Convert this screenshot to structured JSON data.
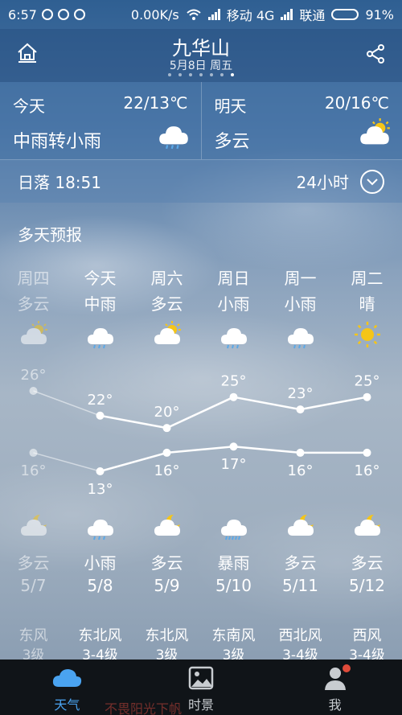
{
  "status_bar": {
    "time": "6:57",
    "speed": "0.00K/s",
    "carrier1": "移动 4G",
    "carrier2": "联通",
    "battery": "91%",
    "battery_level": 0.91
  },
  "header": {
    "city": "九华山",
    "date": "5月8日 周五",
    "page_dots": 7,
    "active_dot": 6,
    "home_icon": "home-icon",
    "share_icon": "share-icon"
  },
  "today": {
    "label": "今天",
    "temp": "22/13℃",
    "condition": "中雨转小雨",
    "icon": "rain-cloud-icon"
  },
  "tomorrow": {
    "label": "明天",
    "temp": "20/16℃",
    "condition": "多云",
    "icon": "partly-cloudy-icon"
  },
  "sunset": {
    "text": "日落 18:51",
    "hours_label": "24小时"
  },
  "forecast_title": "多天预报",
  "chart_data": {
    "type": "line",
    "categories": [
      "5/7",
      "5/8",
      "5/9",
      "5/10",
      "5/11",
      "5/12"
    ],
    "series": [
      {
        "values": [
          26,
          22,
          20,
          25,
          23,
          25
        ]
      },
      {
        "values": [
          16,
          13,
          16,
          17,
          16,
          16
        ]
      }
    ],
    "ylim": [
      13,
      26
    ]
  },
  "days": [
    {
      "weekday": "周四",
      "day_cond": "多云",
      "day_icon": "partly-cloudy-icon",
      "high": "26°",
      "low": "16°",
      "night_icon": "cloudy-night-icon",
      "night_cond": "多云",
      "date": "5/7",
      "wind_dir": "东风",
      "wind_level": "3级"
    },
    {
      "weekday": "今天",
      "day_cond": "中雨",
      "day_icon": "rain-cloud-icon",
      "high": "22°",
      "low": "13°",
      "night_icon": "rain-cloud-icon",
      "night_cond": "小雨",
      "date": "5/8",
      "wind_dir": "东北风",
      "wind_level": "3-4级"
    },
    {
      "weekday": "周六",
      "day_cond": "多云",
      "day_icon": "partly-cloudy-icon",
      "high": "20°",
      "low": "16°",
      "night_icon": "cloudy-night-icon",
      "night_cond": "多云",
      "date": "5/9",
      "wind_dir": "东北风",
      "wind_level": "3级"
    },
    {
      "weekday": "周日",
      "day_cond": "小雨",
      "day_icon": "rain-cloud-icon",
      "high": "25°",
      "low": "17°",
      "night_icon": "heavy-rain-icon",
      "night_cond": "暴雨",
      "date": "5/10",
      "wind_dir": "东南风",
      "wind_level": "3级"
    },
    {
      "weekday": "周一",
      "day_cond": "小雨",
      "day_icon": "rain-cloud-icon",
      "high": "23°",
      "low": "16°",
      "night_icon": "cloudy-night-icon",
      "night_cond": "多云",
      "date": "5/11",
      "wind_dir": "西北风",
      "wind_level": "3-4级"
    },
    {
      "weekday": "周二",
      "day_cond": "晴",
      "day_icon": "sun-icon",
      "high": "25°",
      "low": "16°",
      "night_icon": "cloudy-night-icon",
      "night_cond": "多云",
      "date": "5/12",
      "wind_dir": "西风",
      "wind_level": "3-4级"
    }
  ],
  "tabs": [
    {
      "label": "天气",
      "icon": "weather-cloud-icon",
      "active": true
    },
    {
      "label": "时景",
      "icon": "photo-icon",
      "active": false
    },
    {
      "label": "我",
      "icon": "user-icon",
      "active": false
    }
  ],
  "banner_text": "不畏阳光下帆",
  "colors": {
    "active_tab": "#4aa3f0",
    "tabbar": "#101418",
    "sun": "#f5c518",
    "badge": "#e04b3a"
  }
}
